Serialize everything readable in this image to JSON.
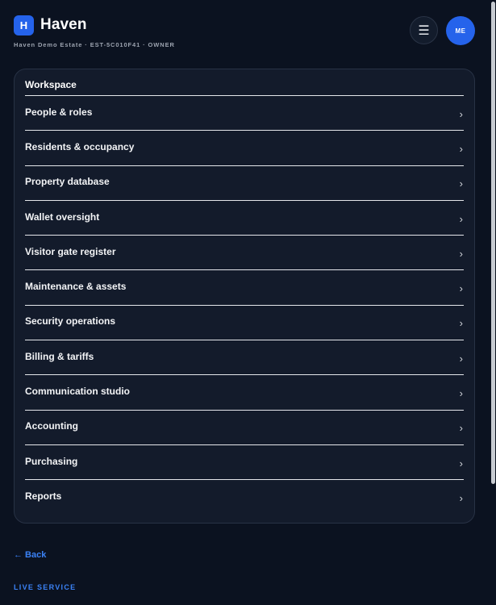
{
  "header": {
    "logo_letter": "H",
    "app_name": "Haven",
    "subtitle": "Haven Demo Estate · EST-5C010F41 · OWNER",
    "menu_icon": "☰",
    "avatar_initials": "ME"
  },
  "workspace": {
    "title": "Workspace",
    "chevron": "›",
    "items": [
      {
        "label": "People & roles"
      },
      {
        "label": "Residents & occupancy"
      },
      {
        "label": "Property database"
      },
      {
        "label": "Wallet oversight"
      },
      {
        "label": "Visitor gate register"
      },
      {
        "label": "Maintenance & assets"
      },
      {
        "label": "Security operations"
      },
      {
        "label": "Billing & tariffs"
      },
      {
        "label": "Communication studio"
      },
      {
        "label": "Accounting"
      },
      {
        "label": "Purchasing"
      },
      {
        "label": "Reports"
      }
    ]
  },
  "footer": {
    "back_label": "← Back",
    "section_label": "LIVE SERVICE"
  },
  "colors": {
    "background": "#0b1220",
    "card": "#131b2b",
    "accent": "#2563eb",
    "link": "#3b82f6"
  }
}
